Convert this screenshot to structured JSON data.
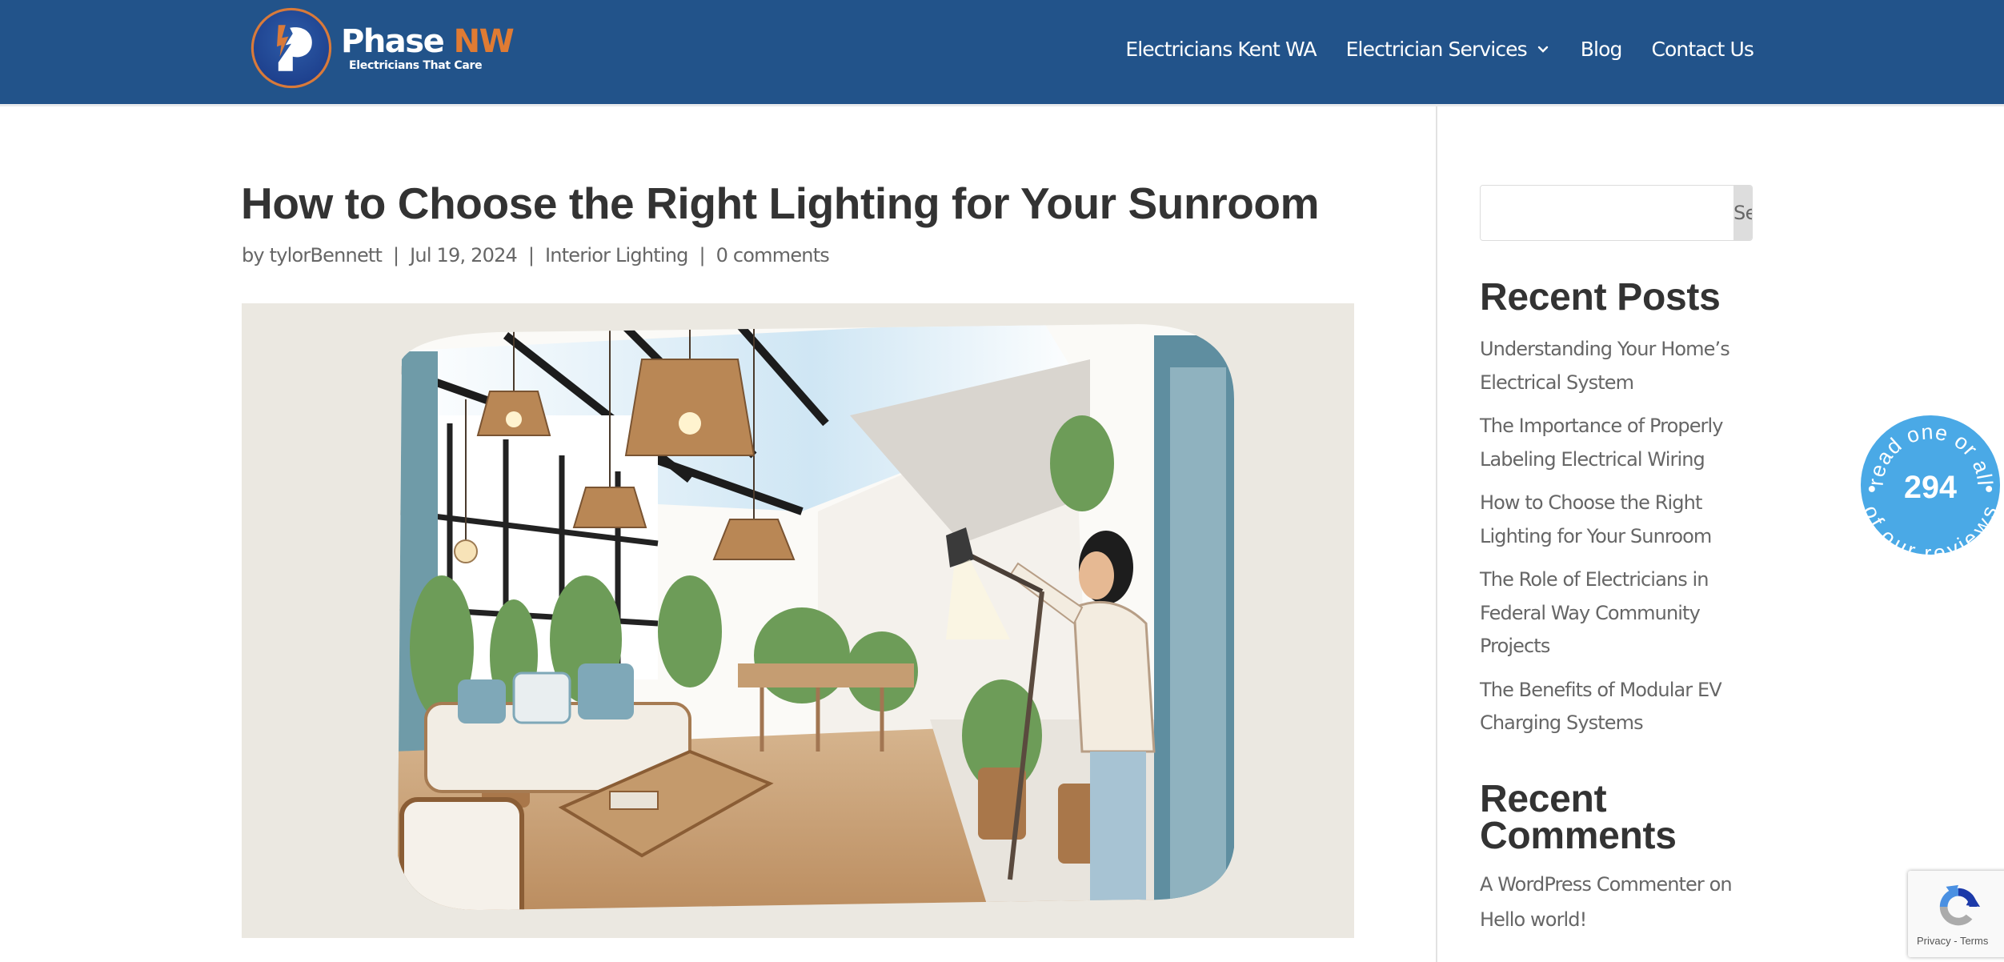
{
  "header": {
    "logo": {
      "name_main": "Phase ",
      "name_accent": "NW",
      "tagline": "Electricians That Care",
      "colors": {
        "accent": "#e07b33",
        "background": "#22538a"
      }
    },
    "nav": [
      {
        "label": "Electricians Kent WA"
      },
      {
        "label": "Electrician Services",
        "has_dropdown": true
      },
      {
        "label": "Blog"
      },
      {
        "label": "Contact Us"
      }
    ]
  },
  "post": {
    "title": "How to Choose the Right Lighting for Your Sunroom",
    "meta": {
      "by": "by ",
      "author": "tylorBennett",
      "date": "Jul 19, 2024",
      "category": "Interior Lighting",
      "comments": "0 comments",
      "separator": "|"
    },
    "featured_image": {
      "alt": "Illustration of a sunroom with rattan pendant lights, plants, a sofa with blue pillows, and a woman adjusting a floor lamp"
    }
  },
  "sidebar": {
    "search": {
      "placeholder": "",
      "value": "",
      "button_label": "Search"
    },
    "recent_posts": {
      "title": "Recent Posts",
      "items": [
        "Understanding Your Home’s Electrical System",
        "The Importance of Properly Labeling Electrical Wiring",
        "How to Choose the Right Lighting for Your Sunroom",
        "The Role of Electricians in Federal Way Community Projects",
        "The Benefits of Modular EV Charging Systems"
      ]
    },
    "recent_comments": {
      "title": "Recent Comments",
      "items": [
        {
          "author": "A WordPress Commenter",
          "on": " on ",
          "post": "Hello world!"
        }
      ]
    }
  },
  "reviews_badge": {
    "top_text": "read one or all",
    "count": "294",
    "bottom_text": "of our reviews",
    "color": "#4aa9e6"
  },
  "recaptcha": {
    "privacy": "Privacy",
    "dash": " - ",
    "terms": "Terms"
  }
}
